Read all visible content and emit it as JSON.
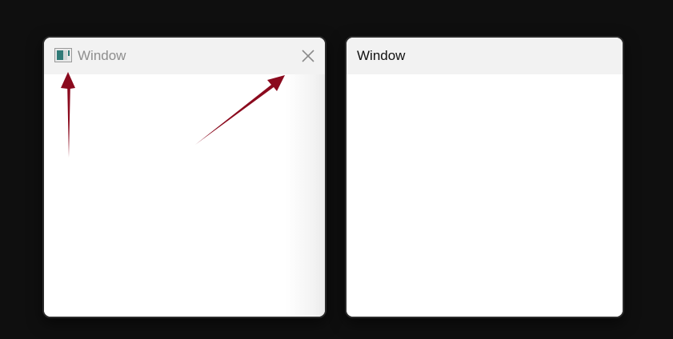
{
  "windows": [
    {
      "title": "Window",
      "icon": "app-window-icon",
      "has_close_button": true,
      "close_icon": "close-icon",
      "title_color": "#8e8e8e"
    },
    {
      "title": "Window",
      "has_close_button": false,
      "title_color": "#111111"
    }
  ],
  "annotations": {
    "arrow_color": "#8b0a1e",
    "arrows": [
      "arrow-to-app-icon",
      "arrow-to-close-button"
    ]
  },
  "colors": {
    "background": "#0f0f0f",
    "titlebar": "#f2f2f2",
    "window_border": "#2a2a2a"
  }
}
